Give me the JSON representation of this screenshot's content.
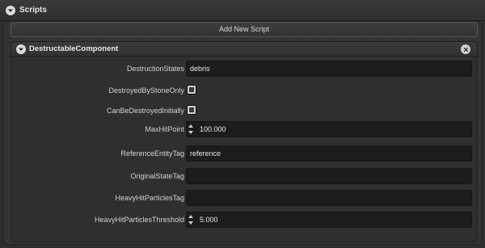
{
  "panel": {
    "title": "Scripts"
  },
  "add_script": {
    "label": "Add New Script"
  },
  "component": {
    "title": "DestructableComponent",
    "properties": [
      {
        "label": "DestructionStates",
        "type": "text",
        "value": "debris"
      },
      {
        "label": "DestroyedByStoneOnly",
        "type": "checkbox",
        "checked": false
      },
      {
        "label": "CanBeDestroyedInitially",
        "type": "checkbox",
        "checked": false
      },
      {
        "label": "MaxHitPoint",
        "type": "number",
        "value": "100.000"
      },
      {
        "label": "ReferenceEntityTag",
        "type": "text",
        "value": "reference"
      },
      {
        "label": "OriginalStateTag",
        "type": "text",
        "value": ""
      },
      {
        "label": "HeavyHitParticlesTag",
        "type": "text",
        "value": ""
      },
      {
        "label": "HeavyHitParticlesThreshold",
        "type": "number",
        "value": "5.000"
      }
    ]
  },
  "icons": {
    "panel_collapse": "chevron-down-icon",
    "component_collapse": "chevron-down-icon",
    "component_close": "close-icon",
    "spinner_up": "arrow-up-icon",
    "spinner_down": "arrow-down-icon"
  },
  "colors": {
    "background": "#2e2e2e",
    "field": "#1c1c1c",
    "text": "#d8d8d8"
  }
}
